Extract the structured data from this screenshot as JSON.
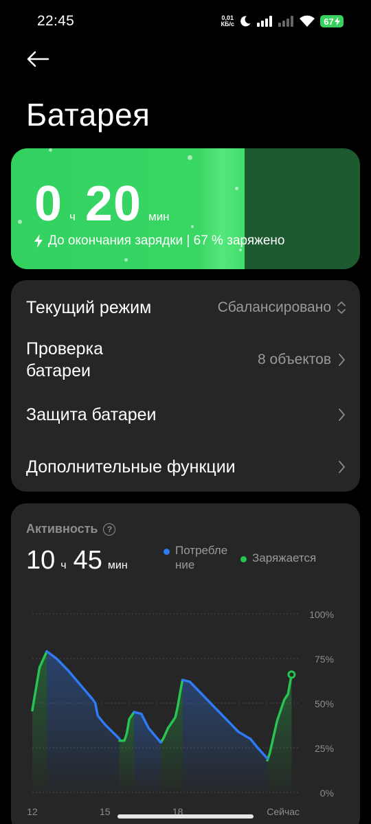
{
  "status": {
    "time": "22:45",
    "net_speed_value": "0,01",
    "net_speed_unit": "КБ/с",
    "battery": "67"
  },
  "header": {
    "title": "Батарея"
  },
  "charging": {
    "hours": "0",
    "hours_unit": "ч",
    "minutes": "20",
    "minutes_unit": "мин",
    "subtitle": "До окончания зарядки | 67 % заряжено",
    "level_percent": 67,
    "fill_color": "#38d663",
    "empty_color": "#1e5a30"
  },
  "settings": {
    "mode_label": "Текущий режим",
    "mode_value": "Сбалансировано",
    "check_label_line1": "Проверка",
    "check_label_line2": "батареи",
    "check_value": "8 объектов",
    "protection_label": "Защита батареи",
    "extra_label": "Дополнительные функции"
  },
  "activity": {
    "title": "Активность",
    "hours": "10",
    "hours_unit": "ч",
    "minutes": "45",
    "minutes_unit": "мин",
    "legend_consumption_line1": "Потребле",
    "legend_consumption_line2": "ние",
    "legend_charging": "Заряжается",
    "consumption_color": "#2f7bf5",
    "charging_color": "#27c452"
  },
  "chart_data": {
    "type": "line",
    "x_tick_labels": [
      "12",
      "15",
      "18",
      "Сейчас"
    ],
    "y_tick_labels": [
      "100%",
      "75%",
      "50%",
      "25%",
      "0%"
    ],
    "ylim": [
      0,
      100
    ],
    "xlim": [
      12,
      23
    ],
    "series": [
      {
        "name": "Заряжается",
        "segments": [
          [
            [
              12.0,
              46
            ],
            [
              12.3,
              70
            ],
            [
              12.6,
              79
            ]
          ],
          [
            [
              15.6,
              29
            ],
            [
              15.8,
              29
            ],
            [
              15.9,
              33
            ],
            [
              16.0,
              41
            ],
            [
              16.2,
              45
            ]
          ],
          [
            [
              17.3,
              28
            ],
            [
              17.4,
              30
            ],
            [
              17.6,
              36
            ],
            [
              17.9,
              42
            ],
            [
              18.0,
              48
            ],
            [
              18.1,
              56
            ],
            [
              18.2,
              63
            ]
          ],
          [
            [
              21.7,
              18
            ],
            [
              21.8,
              22
            ],
            [
              21.9,
              28
            ],
            [
              22.1,
              40
            ],
            [
              22.4,
              52
            ],
            [
              22.55,
              55
            ],
            [
              22.7,
              66
            ]
          ]
        ]
      },
      {
        "name": "Потребление",
        "segments": [
          [
            [
              12.6,
              79
            ],
            [
              13.0,
              75
            ],
            [
              13.5,
              68
            ],
            [
              14.0,
              60
            ],
            [
              14.5,
              52
            ],
            [
              14.6,
              50
            ],
            [
              14.7,
              43
            ],
            [
              15.0,
              38
            ],
            [
              15.3,
              34
            ],
            [
              15.6,
              30
            ]
          ],
          [
            [
              16.2,
              45
            ],
            [
              16.5,
              44
            ],
            [
              16.8,
              36
            ],
            [
              17.3,
              28
            ]
          ],
          [
            [
              18.2,
              63
            ],
            [
              18.5,
              62
            ],
            [
              19.0,
              55
            ],
            [
              19.5,
              48
            ],
            [
              20.0,
              41
            ],
            [
              20.5,
              34
            ],
            [
              21.0,
              30
            ],
            [
              21.3,
              25
            ],
            [
              21.7,
              19
            ]
          ]
        ]
      }
    ],
    "current_point": [
      22.7,
      66
    ]
  }
}
